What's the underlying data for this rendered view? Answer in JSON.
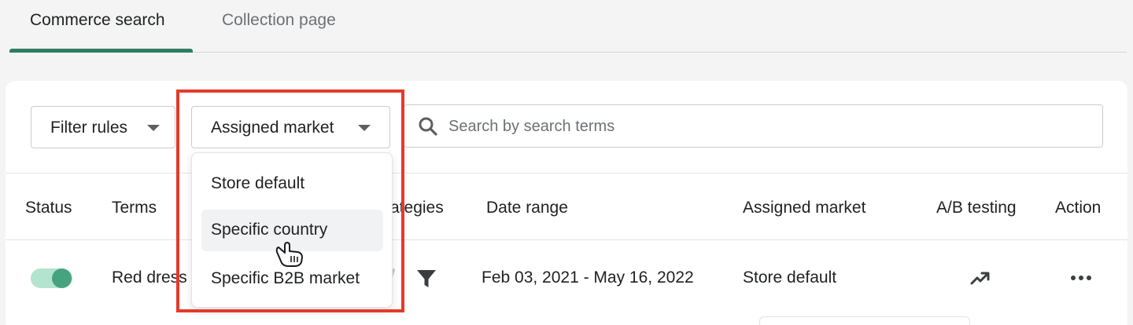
{
  "tabs": [
    {
      "label": "Commerce search",
      "active": true
    },
    {
      "label": "Collection page",
      "active": false
    }
  ],
  "toolbar": {
    "filter_label": "Filter rules",
    "market_label": "Assigned market",
    "search_placeholder": "Search by search terms",
    "search_value": ""
  },
  "market_dropdown": {
    "options": [
      "Store default",
      "Specific country",
      "Specific B2B market"
    ],
    "hovered": "Specific country"
  },
  "table": {
    "headers": {
      "status": "Status",
      "terms": "Terms",
      "strategies": "ategies",
      "date_range": "Date range",
      "assigned_market": "Assigned market",
      "ab_testing": "A/B testing",
      "action": "Action"
    },
    "rows": [
      {
        "status_on": true,
        "terms": "Red dress",
        "date_range": "Feb 03, 2021 - May 16, 2022",
        "assigned_market": "Store default"
      }
    ]
  },
  "colors": {
    "accent": "#2f7d62",
    "toggle_track": "#b4e3cf",
    "toggle_knob": "#47a37f",
    "highlight": "#e53a2a"
  },
  "icons": {
    "search": "search-icon",
    "filter": "filter-funnel-icon",
    "trend": "trending-up-icon",
    "more": "more-horizontal-icon",
    "caret": "caret-down-icon",
    "cursor": "hand-pointer-cursor-icon"
  }
}
